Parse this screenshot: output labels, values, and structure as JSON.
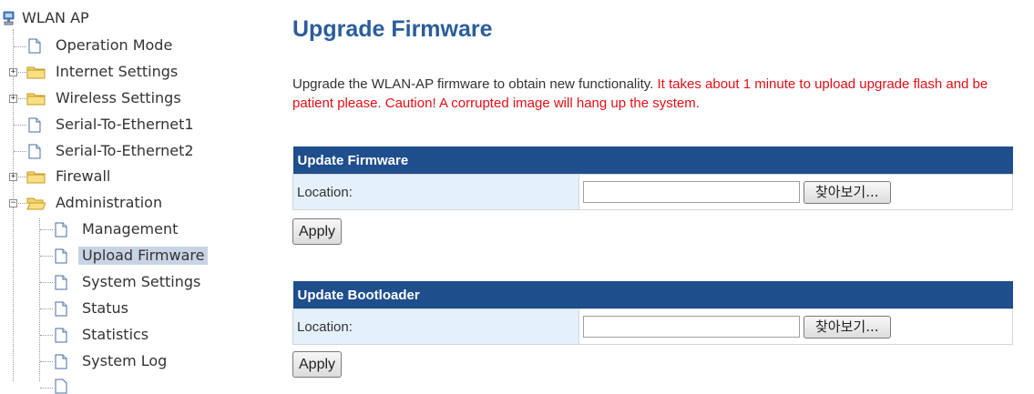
{
  "sidebar": {
    "root": "WLAN AP",
    "items": [
      {
        "label": "Operation Mode",
        "type": "page"
      },
      {
        "label": "Internet Settings",
        "type": "folder"
      },
      {
        "label": "Wireless Settings",
        "type": "folder"
      },
      {
        "label": "Serial-To-Ethernet1",
        "type": "page"
      },
      {
        "label": "Serial-To-Ethernet2",
        "type": "page"
      },
      {
        "label": "Firewall",
        "type": "folder"
      },
      {
        "label": "Administration",
        "type": "folder-open"
      }
    ],
    "admin_items": [
      {
        "label": "Management"
      },
      {
        "label": "Upload Firmware",
        "selected": true
      },
      {
        "label": "System Settings"
      },
      {
        "label": "Status"
      },
      {
        "label": "Statistics"
      },
      {
        "label": "System Log"
      }
    ]
  },
  "main": {
    "title": "Upgrade Firmware",
    "description_normal": "Upgrade the WLAN-AP firmware to obtain new functionality.",
    "description_warning": "It takes about 1 minute to upload upgrade flash and be patient please. Caution! A corrupted image will hang up the system.",
    "firmware": {
      "header": "Update Firmware",
      "location_label": "Location:",
      "browse_label": "찾아보기...",
      "apply_label": "Apply"
    },
    "bootloader": {
      "header": "Update Bootloader",
      "location_label": "Location:",
      "browse_label": "찾아보기...",
      "apply_label": "Apply"
    }
  },
  "colors": {
    "title": "#2b5d9a",
    "table_header": "#1e4e8c",
    "warning": "#e20f16",
    "label_cell": "#e4f1fb",
    "selected": "#c9d3e6"
  }
}
